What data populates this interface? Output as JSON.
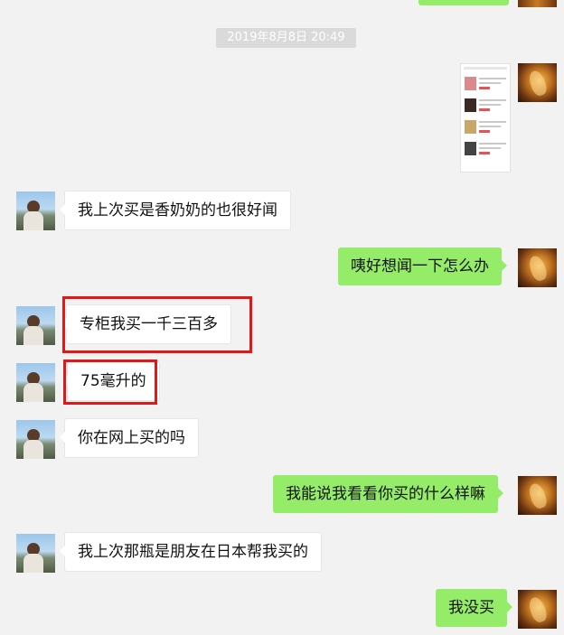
{
  "timestamp": "2019年8月8日 20:49",
  "messages": [
    {
      "side": "out",
      "type": "image"
    },
    {
      "side": "in",
      "text": "我上次买是香奶奶的也很好闻"
    },
    {
      "side": "out",
      "text": "咦好想闻一下怎么办"
    },
    {
      "side": "in",
      "text": "专柜我买一千三百多",
      "highlighted": true
    },
    {
      "side": "in",
      "text": "75毫升的",
      "highlighted": true
    },
    {
      "side": "in",
      "text": "你在网上买的吗"
    },
    {
      "side": "out",
      "text": "我能说我看看你买的什么样嘛"
    },
    {
      "side": "in",
      "text": "我上次那瓶是朋友在日本帮我买的"
    },
    {
      "side": "out",
      "text": "我没买"
    }
  ],
  "colors": {
    "background": "#f2f2f2",
    "outgoing_bubble": "#95ec69",
    "incoming_bubble": "#ffffff",
    "highlight_box": "#e01818",
    "timestamp_bg": "#dadada"
  },
  "icons": {
    "friend_avatar": "friend-avatar-photo",
    "my_avatar": "my-avatar-photo"
  }
}
